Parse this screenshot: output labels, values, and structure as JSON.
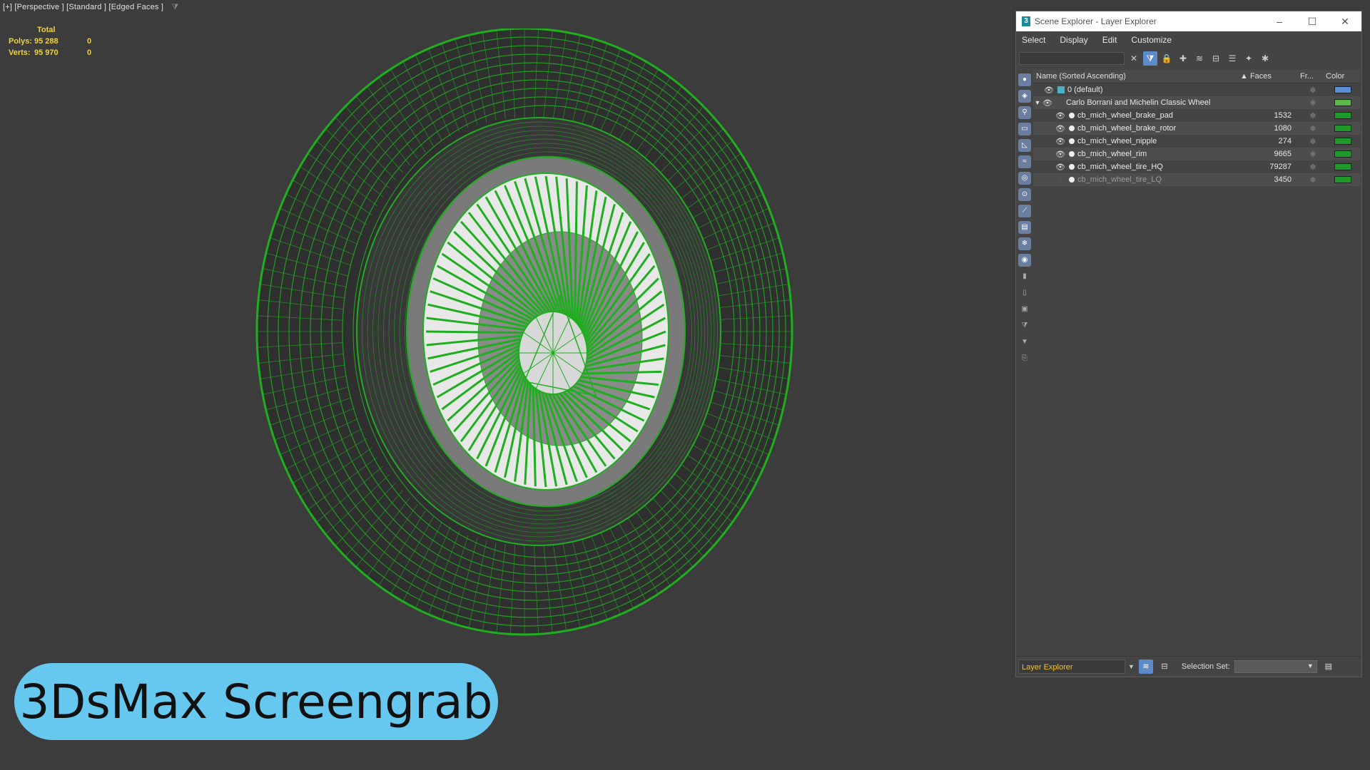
{
  "viewport": {
    "label": "[+] [Perspective ] [Standard ] [Edged Faces ]",
    "stats": {
      "header": "Total",
      "polys_label": "Polys:",
      "polys_value": "95 288",
      "polys_sel": "0",
      "verts_label": "Verts:",
      "verts_value": "95 970",
      "verts_sel": "0"
    },
    "wire_color": "#1fae1f"
  },
  "badge": {
    "text": "3DsMax Screengrab",
    "color": "#67c8ef"
  },
  "explorer": {
    "title": "Scene Explorer - Layer Explorer",
    "app_icon": "3",
    "window_buttons": [
      "–",
      "☐",
      "✕"
    ],
    "menu": [
      "Select",
      "Display",
      "Edit",
      "Customize"
    ],
    "search": {
      "value": "",
      "placeholder": ""
    },
    "columns": {
      "name": "Name (Sorted Ascending)",
      "faces": "▲ Faces",
      "frozen": "Fr...",
      "color": "Color"
    },
    "rows": [
      {
        "name": "0 (default)",
        "faces": "",
        "color": "#5a8fd6",
        "kind": "layer"
      },
      {
        "name": "Carlo Borrani and Michelin Classic Wheel",
        "faces": "",
        "color": "#5ab84a",
        "kind": "group"
      },
      {
        "name": "cb_mich_wheel_brake_pad",
        "faces": "1532",
        "color": "#1e9a2a",
        "kind": "object"
      },
      {
        "name": "cb_mich_wheel_brake_rotor",
        "faces": "1080",
        "color": "#1e9a2a",
        "kind": "object"
      },
      {
        "name": "cb_mich_wheel_nipple",
        "faces": "274",
        "color": "#1e9a2a",
        "kind": "object"
      },
      {
        "name": "cb_mich_wheel_rim",
        "faces": "9665",
        "color": "#1e9a2a",
        "kind": "object"
      },
      {
        "name": "cb_mich_wheel_tire_HQ",
        "faces": "79287",
        "color": "#1e9a2a",
        "kind": "object"
      },
      {
        "name": "cb_mich_wheel_tire_LQ",
        "faces": "3450",
        "color": "#1e9a2a",
        "kind": "hidden"
      }
    ],
    "bottom": {
      "explorer_name": "Layer Explorer",
      "selection_set_label": "Selection Set:",
      "selection_set_value": ""
    }
  }
}
